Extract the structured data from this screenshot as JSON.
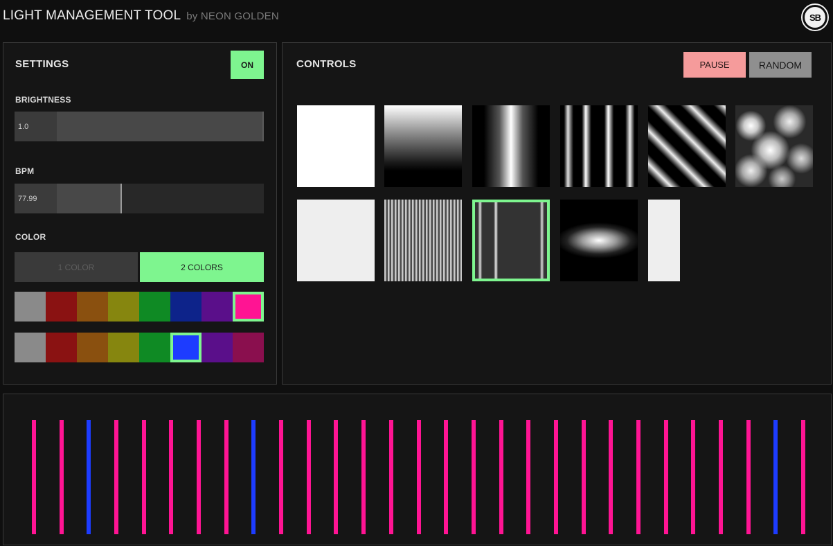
{
  "app": {
    "title": "LIGHT MANAGEMENT TOOL",
    "subtitle": "by NEON GOLDEN",
    "logo_text": "SB"
  },
  "settings": {
    "title": "SETTINGS",
    "power_label": "ON",
    "brightness": {
      "label": "BRIGHTNESS",
      "value": "1.0",
      "fraction": 1.0
    },
    "bpm": {
      "label": "BPM",
      "value": "77.99",
      "fraction": 0.43
    },
    "color": {
      "label": "COLOR",
      "mode_one_label": "1 COLOR",
      "mode_two_label": "2 COLORS",
      "active_mode": "2 COLORS",
      "palette_1": {
        "colors": [
          "#8a8a8a",
          "#8a1212",
          "#8a500f",
          "#86860f",
          "#0f8a24",
          "#0d238a",
          "#5a0f8a",
          "#ff1493"
        ],
        "selected_index": 7
      },
      "palette_2": {
        "colors": [
          "#8a8a8a",
          "#8a1212",
          "#8a500f",
          "#86860f",
          "#0f8a24",
          "#1d3cff",
          "#5a0f8a",
          "#8a0f4e"
        ],
        "selected_index": 5
      }
    }
  },
  "controls": {
    "title": "CONTROLS",
    "pause_label": "PAUSE",
    "random_label": "RANDOM",
    "patterns": [
      "solid-white",
      "vertical-gradient",
      "soft-vertical-band",
      "thin-vertical-lines",
      "diagonal-stripes",
      "noise-clouds",
      "solid-light",
      "dense-vertical-lines",
      "dim-vertical-lines",
      "elliptical-glow",
      "narrow-solid"
    ],
    "selected_pattern_index": 8
  },
  "output": {
    "bars": [
      "pink",
      "pink",
      "blue",
      "pink",
      "pink",
      "pink",
      "pink",
      "pink",
      "blue",
      "pink",
      "pink",
      "pink",
      "pink",
      "pink",
      "pink",
      "pink",
      "pink",
      "pink",
      "pink",
      "pink",
      "pink",
      "pink",
      "pink",
      "pink",
      "pink",
      "pink",
      "pink",
      "blue",
      "pink"
    ],
    "colors": {
      "pink": "#ff1493",
      "blue": "#1d3cff"
    }
  },
  "theme": {
    "accent_green": "#7ef58f",
    "pause_color": "#f59b9b",
    "random_color": "#8f8f8f"
  }
}
